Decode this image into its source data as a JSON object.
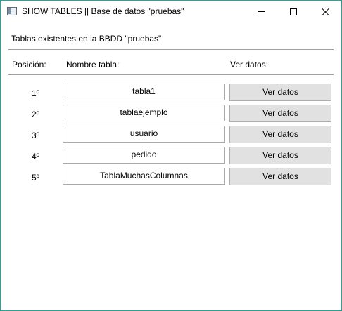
{
  "window": {
    "title": "SHOW TABLES || Base de datos \"pruebas\"",
    "accent_color": "#1fa89a"
  },
  "subtitle": "Tablas existentes en la BBDD \"pruebas\"",
  "headers": {
    "position": "Posición:",
    "name": "Nombre tabla:",
    "view": "Ver datos:"
  },
  "rows": [
    {
      "position": "1º",
      "name": "tabla1",
      "button": "Ver datos"
    },
    {
      "position": "2º",
      "name": "tablaejemplo",
      "button": "Ver datos"
    },
    {
      "position": "3º",
      "name": "usuario",
      "button": "Ver datos"
    },
    {
      "position": "4º",
      "name": "pedido",
      "button": "Ver datos"
    },
    {
      "position": "5º",
      "name": "TablaMuchasColumnas",
      "button": "Ver datos"
    }
  ]
}
